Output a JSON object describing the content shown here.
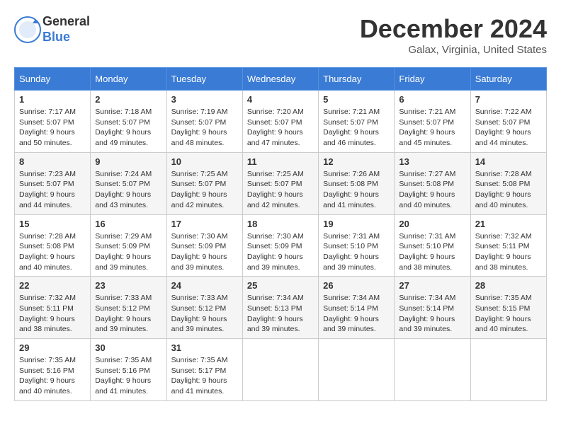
{
  "logo": {
    "general": "General",
    "blue": "Blue"
  },
  "title": "December 2024",
  "location": "Galax, Virginia, United States",
  "days_of_week": [
    "Sunday",
    "Monday",
    "Tuesday",
    "Wednesday",
    "Thursday",
    "Friday",
    "Saturday"
  ],
  "weeks": [
    [
      {
        "day": "1",
        "sunrise": "7:17 AM",
        "sunset": "5:07 PM",
        "daylight": "9 hours and 50 minutes."
      },
      {
        "day": "2",
        "sunrise": "7:18 AM",
        "sunset": "5:07 PM",
        "daylight": "9 hours and 49 minutes."
      },
      {
        "day": "3",
        "sunrise": "7:19 AM",
        "sunset": "5:07 PM",
        "daylight": "9 hours and 48 minutes."
      },
      {
        "day": "4",
        "sunrise": "7:20 AM",
        "sunset": "5:07 PM",
        "daylight": "9 hours and 47 minutes."
      },
      {
        "day": "5",
        "sunrise": "7:21 AM",
        "sunset": "5:07 PM",
        "daylight": "9 hours and 46 minutes."
      },
      {
        "day": "6",
        "sunrise": "7:21 AM",
        "sunset": "5:07 PM",
        "daylight": "9 hours and 45 minutes."
      },
      {
        "day": "7",
        "sunrise": "7:22 AM",
        "sunset": "5:07 PM",
        "daylight": "9 hours and 44 minutes."
      }
    ],
    [
      {
        "day": "8",
        "sunrise": "7:23 AM",
        "sunset": "5:07 PM",
        "daylight": "9 hours and 44 minutes."
      },
      {
        "day": "9",
        "sunrise": "7:24 AM",
        "sunset": "5:07 PM",
        "daylight": "9 hours and 43 minutes."
      },
      {
        "day": "10",
        "sunrise": "7:25 AM",
        "sunset": "5:07 PM",
        "daylight": "9 hours and 42 minutes."
      },
      {
        "day": "11",
        "sunrise": "7:25 AM",
        "sunset": "5:07 PM",
        "daylight": "9 hours and 42 minutes."
      },
      {
        "day": "12",
        "sunrise": "7:26 AM",
        "sunset": "5:08 PM",
        "daylight": "9 hours and 41 minutes."
      },
      {
        "day": "13",
        "sunrise": "7:27 AM",
        "sunset": "5:08 PM",
        "daylight": "9 hours and 40 minutes."
      },
      {
        "day": "14",
        "sunrise": "7:28 AM",
        "sunset": "5:08 PM",
        "daylight": "9 hours and 40 minutes."
      }
    ],
    [
      {
        "day": "15",
        "sunrise": "7:28 AM",
        "sunset": "5:08 PM",
        "daylight": "9 hours and 40 minutes."
      },
      {
        "day": "16",
        "sunrise": "7:29 AM",
        "sunset": "5:09 PM",
        "daylight": "9 hours and 39 minutes."
      },
      {
        "day": "17",
        "sunrise": "7:30 AM",
        "sunset": "5:09 PM",
        "daylight": "9 hours and 39 minutes."
      },
      {
        "day": "18",
        "sunrise": "7:30 AM",
        "sunset": "5:09 PM",
        "daylight": "9 hours and 39 minutes."
      },
      {
        "day": "19",
        "sunrise": "7:31 AM",
        "sunset": "5:10 PM",
        "daylight": "9 hours and 39 minutes."
      },
      {
        "day": "20",
        "sunrise": "7:31 AM",
        "sunset": "5:10 PM",
        "daylight": "9 hours and 38 minutes."
      },
      {
        "day": "21",
        "sunrise": "7:32 AM",
        "sunset": "5:11 PM",
        "daylight": "9 hours and 38 minutes."
      }
    ],
    [
      {
        "day": "22",
        "sunrise": "7:32 AM",
        "sunset": "5:11 PM",
        "daylight": "9 hours and 38 minutes."
      },
      {
        "day": "23",
        "sunrise": "7:33 AM",
        "sunset": "5:12 PM",
        "daylight": "9 hours and 39 minutes."
      },
      {
        "day": "24",
        "sunrise": "7:33 AM",
        "sunset": "5:12 PM",
        "daylight": "9 hours and 39 minutes."
      },
      {
        "day": "25",
        "sunrise": "7:34 AM",
        "sunset": "5:13 PM",
        "daylight": "9 hours and 39 minutes."
      },
      {
        "day": "26",
        "sunrise": "7:34 AM",
        "sunset": "5:14 PM",
        "daylight": "9 hours and 39 minutes."
      },
      {
        "day": "27",
        "sunrise": "7:34 AM",
        "sunset": "5:14 PM",
        "daylight": "9 hours and 39 minutes."
      },
      {
        "day": "28",
        "sunrise": "7:35 AM",
        "sunset": "5:15 PM",
        "daylight": "9 hours and 40 minutes."
      }
    ],
    [
      {
        "day": "29",
        "sunrise": "7:35 AM",
        "sunset": "5:16 PM",
        "daylight": "9 hours and 40 minutes."
      },
      {
        "day": "30",
        "sunrise": "7:35 AM",
        "sunset": "5:16 PM",
        "daylight": "9 hours and 41 minutes."
      },
      {
        "day": "31",
        "sunrise": "7:35 AM",
        "sunset": "5:17 PM",
        "daylight": "9 hours and 41 minutes."
      },
      null,
      null,
      null,
      null
    ]
  ]
}
